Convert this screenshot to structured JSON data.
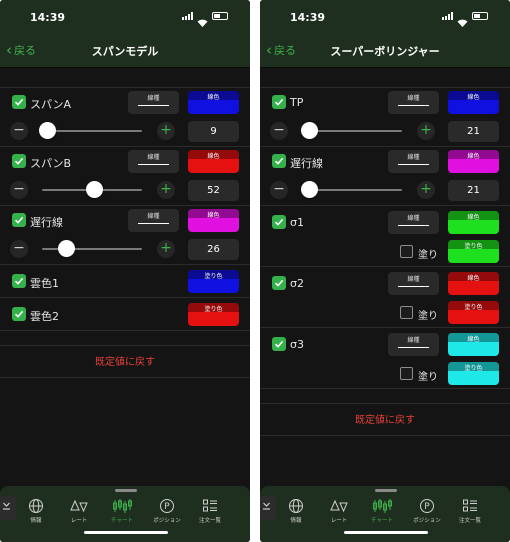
{
  "status": {
    "time": "14:39"
  },
  "back_label": "戻る",
  "labels": {
    "line_type": "線種",
    "line_color": "線色",
    "fill_color": "塗り色",
    "fill": "塗り"
  },
  "left": {
    "title": "スパンモデル",
    "rows": [
      {
        "label": "スパンA",
        "color": "#1010e0",
        "value": "9",
        "slider": 0.05
      },
      {
        "label": "スパンB",
        "color": "#e51010",
        "value": "52",
        "slider": 0.52
      },
      {
        "label": "遅行線",
        "color": "#e010e0",
        "value": "26",
        "slider": 0.24
      }
    ],
    "clouds": [
      {
        "label": "雲色1",
        "color": "#1010e0"
      },
      {
        "label": "雲色2",
        "color": "#e51010"
      }
    ],
    "reset": "既定値に戻す"
  },
  "right": {
    "title": "スーパーボリンジャー",
    "rows": [
      {
        "label": "TP",
        "color": "#1010e0",
        "value": "21",
        "slider": 0.07
      },
      {
        "label": "遅行線",
        "color": "#e010e0",
        "value": "21",
        "slider": 0.07
      }
    ],
    "sigmas": [
      {
        "label": "σ1",
        "color": "#1ee01e",
        "fill_color": "#1ee01e"
      },
      {
        "label": "σ2",
        "color": "#e51010",
        "fill_color": "#e51010"
      },
      {
        "label": "σ3",
        "color": "#1ee8e8",
        "fill_color": "#1ee8e8"
      }
    ],
    "reset": "既定値に戻す"
  },
  "tabs": [
    {
      "label": "情報",
      "icon": "globe-icon"
    },
    {
      "label": "レート",
      "icon": "rate-icon"
    },
    {
      "label": "チャート",
      "icon": "chart-icon",
      "active": true
    },
    {
      "label": "ポジション",
      "icon": "position-icon"
    },
    {
      "label": "注文一覧",
      "icon": "order-list-icon"
    }
  ],
  "colors": {
    "accent": "#3db14c",
    "bar": "#1f2f1f",
    "background": "#141414",
    "reset": "#e8413a"
  }
}
